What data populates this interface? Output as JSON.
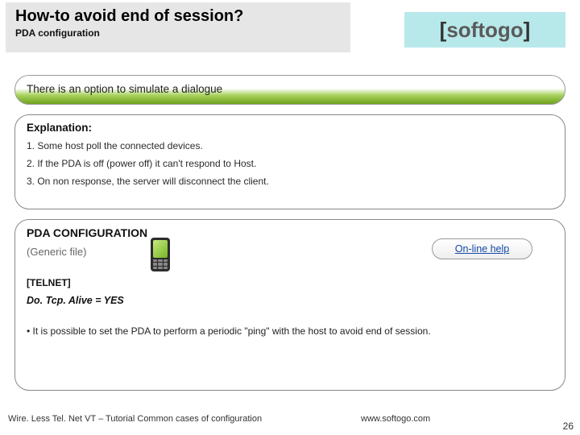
{
  "header": {
    "title": "How-to avoid end of session?",
    "subtitle": "PDA configuration"
  },
  "logo": {
    "prefix": "[",
    "main": "softogo",
    "suffix": "]"
  },
  "intro": "There is an option to simulate a dialogue",
  "explanation": {
    "heading": "Explanation:",
    "lines": [
      "1. Some host poll the connected devices.",
      "2. If the PDA is off (power off) it can't respond to Host.",
      "3. On non response, the server will disconnect the client."
    ]
  },
  "config": {
    "heading": "PDA CONFIGURATION",
    "sub": "(Generic file)",
    "help": "On-line help",
    "telnet": "[TELNET]",
    "setting": "Do. Tcp. Alive  = YES",
    "bullet": "•  It is possible to set the PDA to perform a periodic \"ping\" with the host to avoid end of session."
  },
  "footer": {
    "left": "Wire. Less Tel. Net VT – Tutorial Common cases of configuration",
    "url": "www.softogo.com",
    "page": "26"
  }
}
